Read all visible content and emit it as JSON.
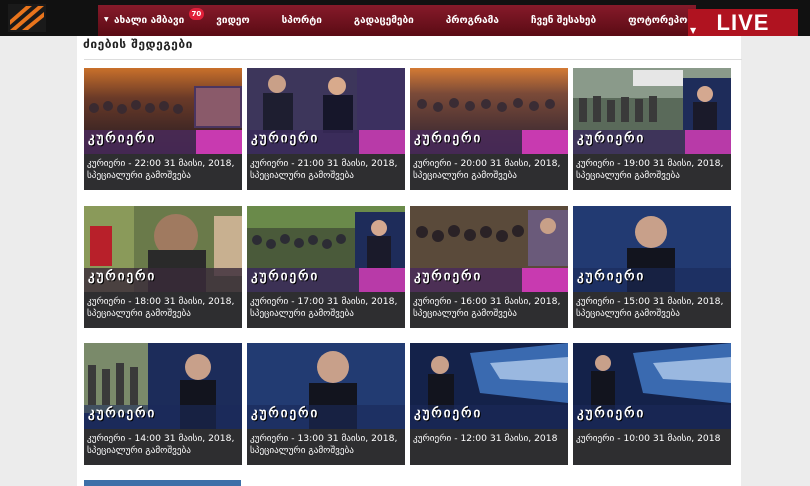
{
  "header": {
    "nav": [
      {
        "label": "ახალი ამბავი",
        "badge": "70"
      },
      {
        "label": "ვიდეო"
      },
      {
        "label": "სპორტი"
      },
      {
        "label": "გადაცემები"
      },
      {
        "label": "პროგრამა"
      },
      {
        "label": "ჩვენ შესახებ"
      },
      {
        "label": "ფოტორეპორტაჟი"
      }
    ],
    "live_label": "LIVE"
  },
  "section": {
    "title": "ძიების შედეგები"
  },
  "colors": {
    "nav_bg": "#7a1524",
    "live_bg": "#b01320",
    "card_bg": "#2e2e30"
  },
  "cards": [
    {
      "brand": "კურიერი",
      "line1": "კურიერი - 22:00 31 მაისი, 2018,",
      "line2": "სპეციალური გამოშვება"
    },
    {
      "brand": "კურიერი",
      "line1": "კურიერი - 21:00 31 მაისი, 2018,",
      "line2": "სპეციალური გამოშვება"
    },
    {
      "brand": "კურიერი",
      "line1": "კურიერი - 20:00 31 მაისი, 2018,",
      "line2": "სპეციალური გამოშვება"
    },
    {
      "brand": "კურიერი",
      "line1": "კურიერი - 19:00 31 მაისი, 2018,",
      "line2": "სპეციალური გამოშვება"
    },
    {
      "brand": "კურიერი",
      "line1": "კურიერი - 18:00 31 მაისი, 2018,",
      "line2": "სპეციალური გამოშვება"
    },
    {
      "brand": "კურიერი",
      "line1": "კურიერი - 17:00 31 მაისი, 2018,",
      "line2": "სპეციალური გამოშვება"
    },
    {
      "brand": "კურიერი",
      "line1": "კურიერი - 16:00 31 მაისი, 2018,",
      "line2": "სპეციალური გამოშვება"
    },
    {
      "brand": "კურიერი",
      "line1": "კურიერი - 15:00 31 მაისი, 2018,",
      "line2": "სპეციალური გამოშვება"
    },
    {
      "brand": "კურიერი",
      "line1": "კურიერი - 14:00 31 მაისი, 2018,",
      "line2": "სპეციალური გამოშვება"
    },
    {
      "brand": "კურიერი",
      "line1": "კურიერი - 13:00 31 მაისი, 2018,",
      "line2": "სპეციალური გამოშვება"
    },
    {
      "brand": "კურიერი",
      "line1": "კურიერი - 12:00 31 მაისი, 2018",
      "line2": ""
    },
    {
      "brand": "კურიერი",
      "line1": "კურიერი - 10:00 31 მაისი, 2018",
      "line2": ""
    }
  ]
}
